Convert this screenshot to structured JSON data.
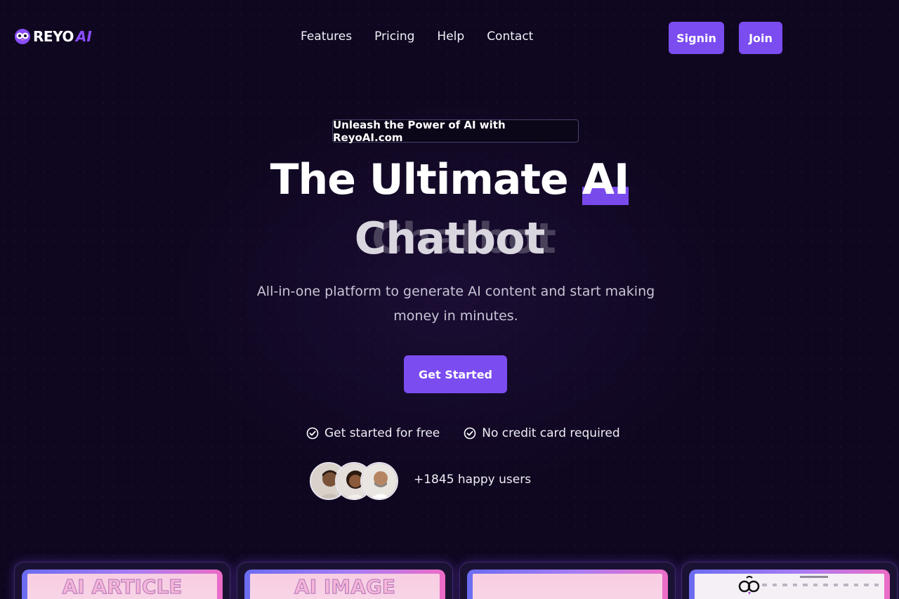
{
  "brand": {
    "name_main": "REYO",
    "name_ai": "AI",
    "accent": "#7b4cf0"
  },
  "nav": {
    "links": [
      "Features",
      "Pricing",
      "Help",
      "Contact"
    ],
    "signin_label": "Signin",
    "join_label": "Join"
  },
  "hero": {
    "badge": "Unleash the Power of AI with ReyoAI.com",
    "title_prefix": "The Ultimate ",
    "title_highlight": "AI",
    "title_line2": "Chatbot",
    "title_ghost": "Chatbot",
    "subtitle": "All-in-one platform to generate AI content and start making money in minutes.",
    "cta_label": "Get Started",
    "checks": [
      "Get started for free",
      "No credit card required"
    ],
    "users_text": "+1845 happy users"
  },
  "cards": [
    {
      "title": "AI ARTICLE"
    },
    {
      "title": "AI IMAGE"
    },
    {
      "title": ""
    },
    {
      "title": ""
    }
  ],
  "icons": {
    "logo": "owl-logo-icon",
    "check": "check-circle-icon",
    "card4_logo": "owl-logo-icon"
  }
}
